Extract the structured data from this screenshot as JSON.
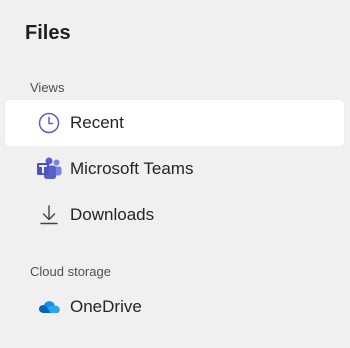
{
  "header": {
    "title": "Files"
  },
  "sections": [
    {
      "label": "Views",
      "items": [
        {
          "label": "Recent",
          "icon": "clock-icon",
          "selected": true
        },
        {
          "label": "Microsoft Teams",
          "icon": "teams-icon",
          "selected": false
        },
        {
          "label": "Downloads",
          "icon": "download-icon",
          "selected": false
        }
      ]
    },
    {
      "label": "Cloud storage",
      "items": [
        {
          "label": "OneDrive",
          "icon": "onedrive-icon",
          "selected": false
        }
      ]
    }
  ],
  "colors": {
    "accent": "#5b5fc7",
    "onedrive": "#0f78d4",
    "background": "#f0f0f0",
    "selected_background": "#ffffff"
  }
}
